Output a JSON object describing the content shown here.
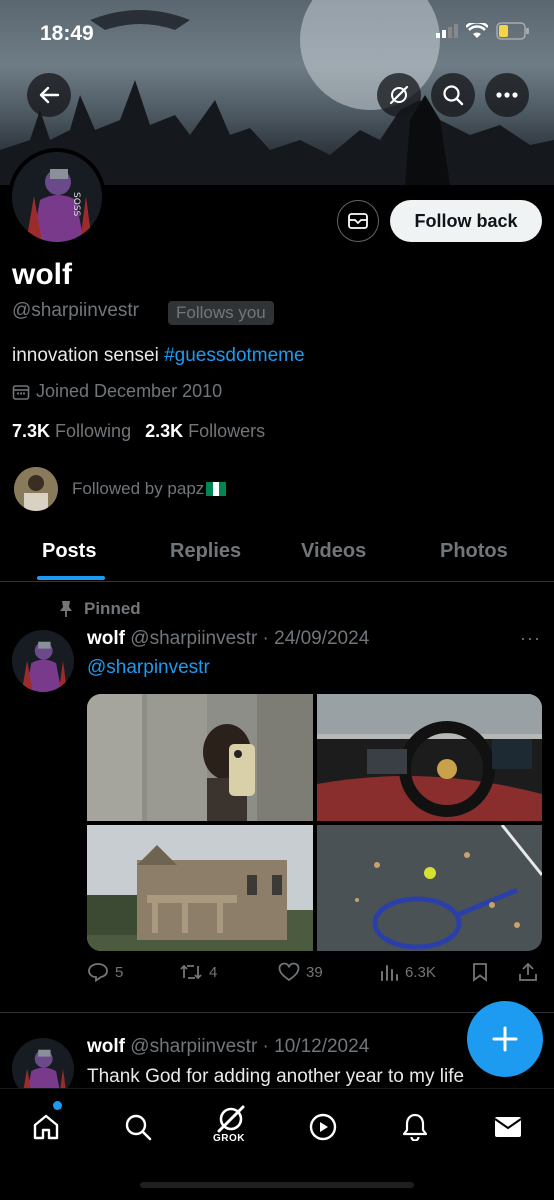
{
  "status_bar": {
    "time": "18:49"
  },
  "profile": {
    "name": "wolf",
    "handle": "@sharpiinvestr",
    "follows_you": "Follows you",
    "bio_text": "innovation sensei ",
    "bio_hashtag": "#guessdotmeme",
    "joined": "Joined December 2010",
    "following_count": "7.3K",
    "following_label": "Following",
    "followers_count": "2.3K",
    "followers_label": "Followers",
    "followed_by": "Followed by papz",
    "follow_back_label": "Follow back"
  },
  "tabs": [
    {
      "label": "Posts",
      "active": true
    },
    {
      "label": "Replies",
      "active": false
    },
    {
      "label": "Videos",
      "active": false
    },
    {
      "label": "Photos",
      "active": false
    }
  ],
  "posts": [
    {
      "pinned_label": "Pinned",
      "author": "wolf",
      "handle_date": "@sharpiinvestr · 24/09/2024",
      "text": "@sharpinvestr",
      "replies": "5",
      "reposts": "4",
      "likes": "39",
      "views": "6.3K"
    },
    {
      "author": "wolf",
      "handle_date": "@sharpiinvestr · 10/12/2024",
      "text": "Thank God for adding another year to my life"
    }
  ],
  "bottom_nav": {
    "grok_label": "GROK"
  },
  "colors": {
    "accent": "#1d9bf0",
    "background": "#000000",
    "muted": "#71767b"
  },
  "icons": [
    "back-arrow-icon",
    "grok-icon",
    "search-icon",
    "more-icon",
    "mail-icon",
    "calendar-icon",
    "pin-icon",
    "reply-icon",
    "repost-icon",
    "like-icon",
    "views-icon",
    "bookmark-icon",
    "share-icon",
    "plus-icon",
    "home-icon",
    "play-icon",
    "bell-icon",
    "envelope-icon"
  ]
}
